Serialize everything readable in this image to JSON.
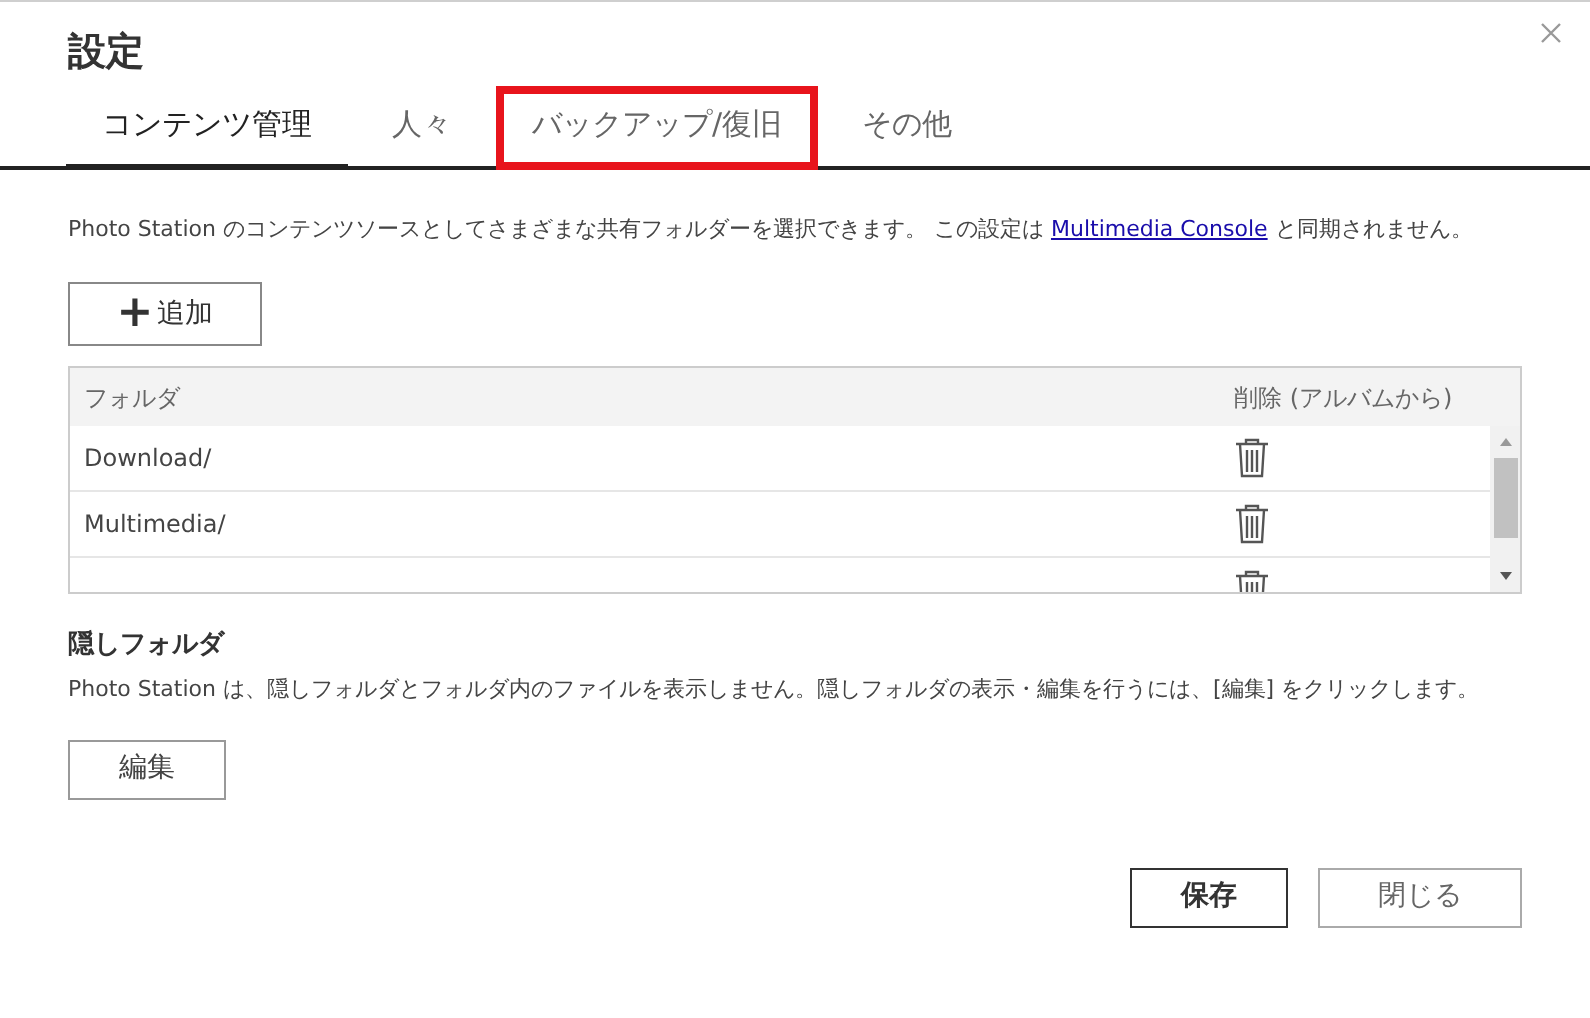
{
  "dialog": {
    "title": "設定"
  },
  "tabs": [
    {
      "label": "コンテンツ管理",
      "selected": true,
      "highlighted": false
    },
    {
      "label": "人々",
      "selected": false,
      "highlighted": false
    },
    {
      "label": "バックアップ/復旧",
      "selected": false,
      "highlighted": true
    },
    {
      "label": "その他",
      "selected": false,
      "highlighted": false
    }
  ],
  "description": {
    "before": "Photo Station のコンテンツソースとしてさまざまな共有フォルダーを選択できます。 この設定は",
    "link": "Multimedia Console",
    "after": "と同期されません。"
  },
  "add_button": {
    "icon": "+",
    "label": "追加"
  },
  "table": {
    "columns": [
      "フォルダ",
      "削除 (アルバムから)"
    ],
    "rows": [
      {
        "folder": "Download/"
      },
      {
        "folder": "Multimedia/"
      },
      {}
    ]
  },
  "hidden_folders": {
    "heading": "隠しフォルダ",
    "text": "Photo Station は、隠しフォルダとフォルダ内のファイルを表示しません。隠しフォルダの表示・編集を行うには、[編集] をクリックします。",
    "edit_button": "編集"
  },
  "footer_buttons": [
    {
      "label": "保存",
      "primary": true
    },
    {
      "label": "閉じる",
      "primary": false
    }
  ]
}
